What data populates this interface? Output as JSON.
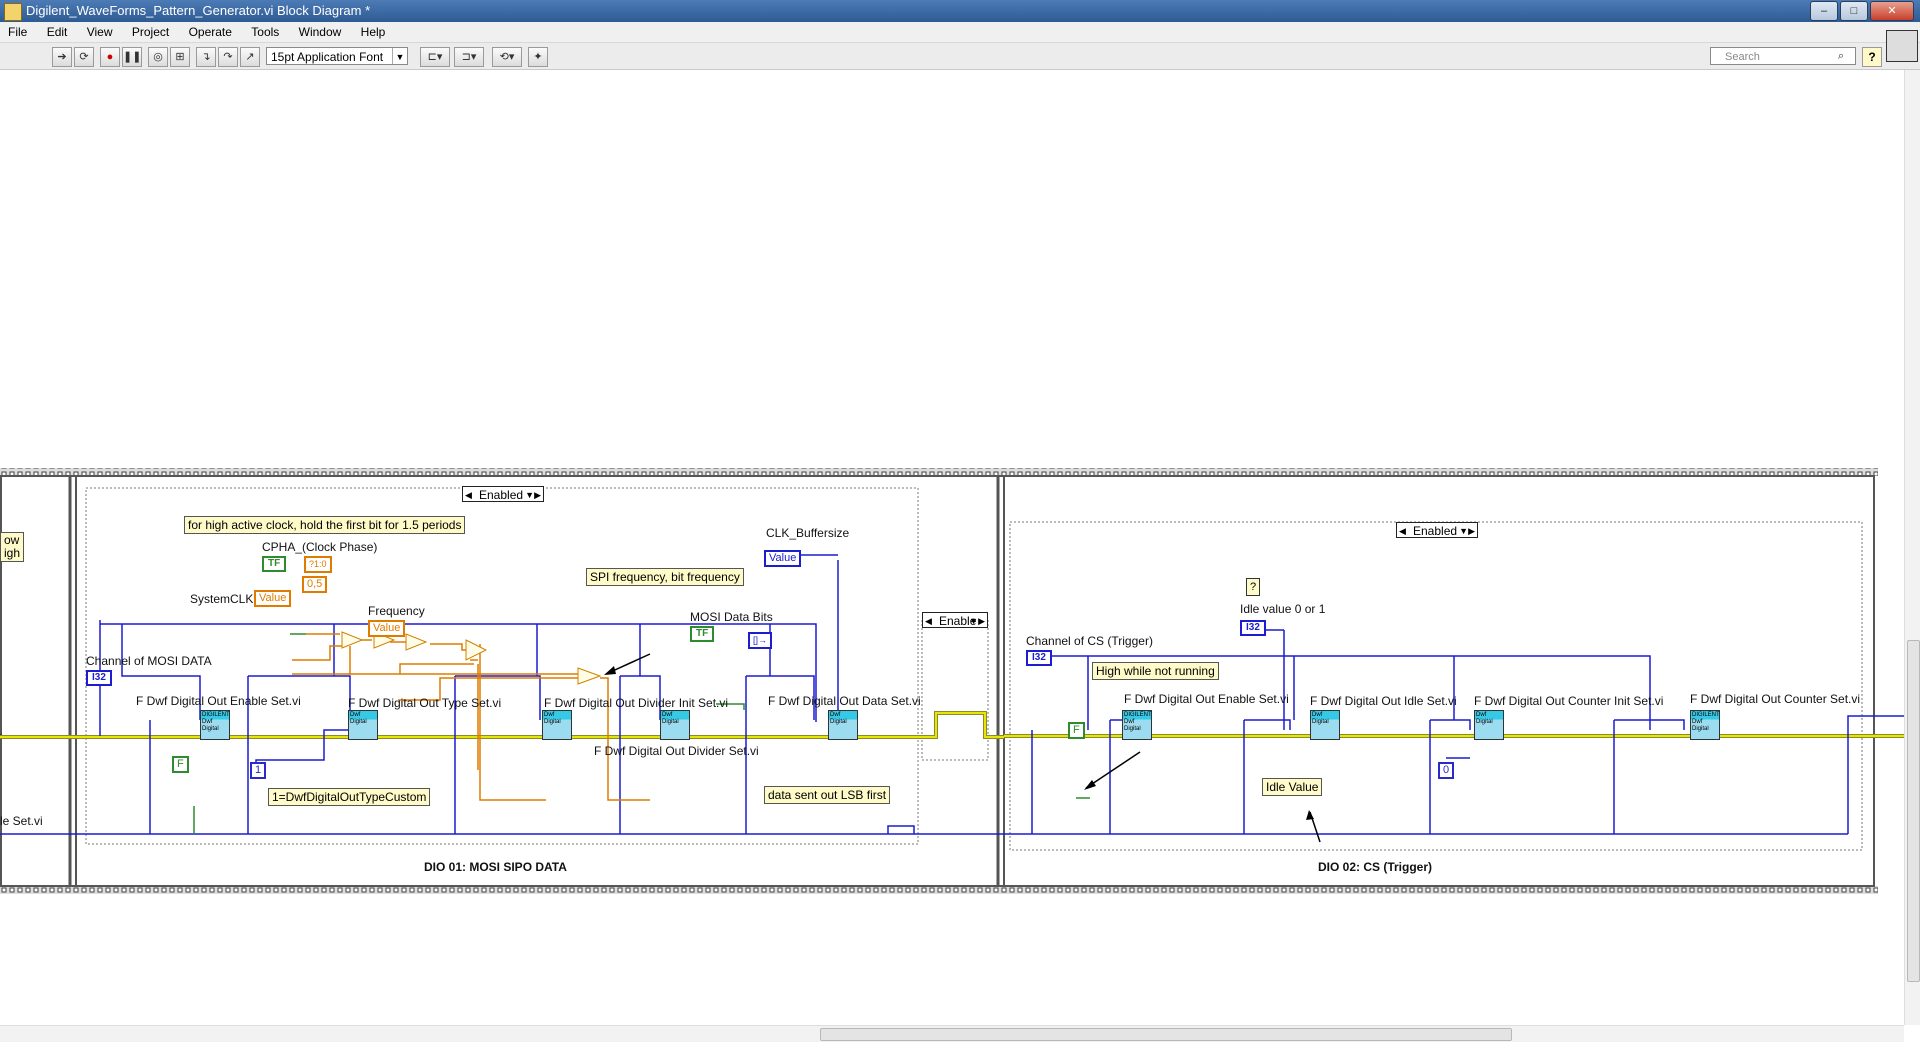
{
  "window": {
    "title": "Digilent_WaveForms_Pattern_Generator.vi Block Diagram *",
    "buttons": [
      "–",
      "□",
      "✕"
    ]
  },
  "menu": [
    "File",
    "Edit",
    "View",
    "Project",
    "Operate",
    "Tools",
    "Window",
    "Help"
  ],
  "toolbar": {
    "font": "15pt Application Font",
    "search_placeholder": "Search",
    "help": "?"
  },
  "diagram": {
    "left_partial": {
      "comment_lines": [
        "ow",
        "igh"
      ],
      "vi_label": "le Set.vi"
    },
    "frame1": {
      "caption": "DIO 01: MOSI SIPO DATA",
      "selector": "Enabled",
      "comment_clock": "for high active clock, hold the first bit for 1.5 periods",
      "cpha_label": "CPHA_(Clock Phase)",
      "cpha_term": "TF",
      "const_05": "0,5",
      "systemclk_label": "SystemCLK",
      "systemclk_value": "Value",
      "frequency_label": "Frequency",
      "frequency_value": "Value",
      "spi_comment": "SPI frequency, bit frequency",
      "clk_buffersize_label": "CLK_Buffersize",
      "clk_buffersize_value": "Value",
      "mosi_bits_label": "MOSI Data Bits",
      "mosi_bits_term": "TF",
      "channel_label": "Channel of MOSI DATA",
      "channel_term": "I32",
      "vi_enable": "F Dwf Digital Out Enable Set.vi",
      "vi_type": "F Dwf Digital Out Type Set.vi",
      "vi_divider_init": "F Dwf Digital Out Divider Init Set.vi",
      "vi_data": "F Dwf Digital Out Data Set.vi",
      "vi_divider": "F Dwf Digital Out Divider Set.vi",
      "const_f": "F",
      "const_1": "1",
      "type_comment": "1=DwfDigitalOutTypeCustom",
      "lsb_comment": "data sent out LSB first"
    },
    "enable_selector": "Enable",
    "frame2": {
      "caption": "DIO 02: CS (Trigger)",
      "selector": "Enabled",
      "qmark": "?",
      "idle_label": "Idle value 0 or 1",
      "idle_term": "I32",
      "channel_label": "Channel of CS (Trigger)",
      "channel_term": "I32",
      "high_comment": "High while not running",
      "const_f": "F",
      "vi_enable": "F Dwf Digital Out Enable Set.vi",
      "vi_idle": "F Dwf Digital Out Idle Set.vi",
      "vi_counter_init": "F Dwf Digital Out Counter Init Set.vi",
      "vi_counter": "F Dwf Digital Out Counter Set.vi",
      "idle_comment": "Idle Value",
      "const_0": "0"
    },
    "node_text": {
      "top": "DIGILENT",
      "mid": "Dwf",
      "bot": "Digital"
    }
  },
  "colors": {
    "error_wire": "#d6d600",
    "ref_wire": "#1c1cd0",
    "numeric_wire": "#e07b00",
    "bool_wire": "#2e8b2e",
    "frame": "#555555"
  }
}
